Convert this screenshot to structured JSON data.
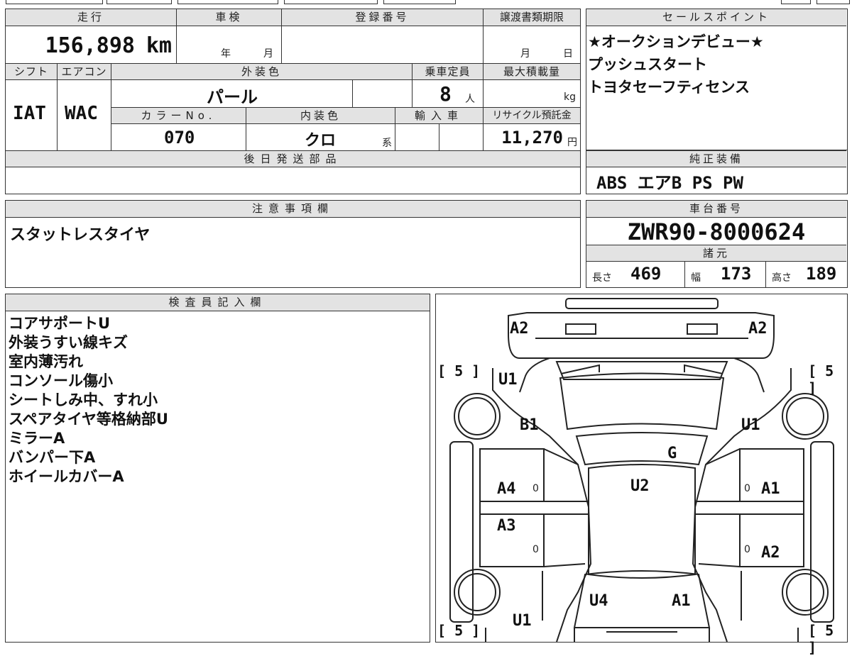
{
  "top_table": {
    "mileage_header": "走行",
    "shaken_header": "車検",
    "reg_header": "登録番号",
    "transfer_header": "譲渡書類期限",
    "mileage_value": "156,898",
    "mileage_unit": "km",
    "shaken_year": "年",
    "shaken_month": "月",
    "transfer_month": "月",
    "transfer_day": "日",
    "shift_header": "シフト",
    "ac_header": "エアコン",
    "exterior_header": "外装色",
    "capacity_header": "乗車定員",
    "maxload_header": "最大積載量",
    "shift_value": "IAT",
    "ac_value": "WAC",
    "exterior_value": "パール",
    "capacity_value": "8",
    "capacity_unit": "人",
    "maxload_unit": "kg",
    "colorno_header": "カラーNo.",
    "interior_header": "内装色",
    "import_header": "輸入車",
    "recycle_header": "リサイクル預託金",
    "colorno_value": "070",
    "interior_value": "クロ",
    "interior_suffix": "系",
    "recycle_value": "11,270",
    "recycle_unit": "円",
    "later_parts_header": "後日発送部品"
  },
  "sales_points": {
    "header": "セールスポイント",
    "lines": [
      "★オークションデビュー★",
      "プッシュスタート",
      "トヨタセーフティセンス"
    ]
  },
  "equipment": {
    "header": "純正装備",
    "value": "ABS エアB PS PW"
  },
  "caution": {
    "header": "注意事項欄",
    "value": "スタットレスタイヤ"
  },
  "chassis": {
    "header": "車台番号",
    "value": "ZWR90-8000624",
    "spec_header": "諸元",
    "length_label": "長さ",
    "length_value": "469",
    "width_label": "幅",
    "width_value": "173",
    "height_label": "高さ",
    "height_value": "189"
  },
  "inspector": {
    "header": "検査員記入欄",
    "notes": [
      "コアサポートU",
      "外装うすい線キズ",
      "室内薄汚れ",
      "コンソール傷小",
      "シートしみ中、すれ小",
      "スペアタイヤ等格納部U",
      "ミラーA",
      "バンパー下A",
      "ホイールカバーA"
    ]
  },
  "diagram": {
    "labels": {
      "front_left": "A2",
      "front_right": "A2",
      "fender_left": "U1",
      "hood_left": "B1",
      "fender_right": "U1",
      "windshield": "G",
      "roof": "U2",
      "door_rl": "A4",
      "door_rr": "A1",
      "door_rl2": "A3",
      "door_rr2": "A2",
      "rear_gate": "U4",
      "rear_right": "A1",
      "rear_left": "U1"
    },
    "tire_tl": "[ 5 ]",
    "tire_tr": "[ 5 ]",
    "tire_bl": "[ 5 ]",
    "tire_br": "[ 5 ]",
    "zero_a": "0",
    "zero_b": "0",
    "zero_c": "0",
    "zero_d": "0"
  }
}
